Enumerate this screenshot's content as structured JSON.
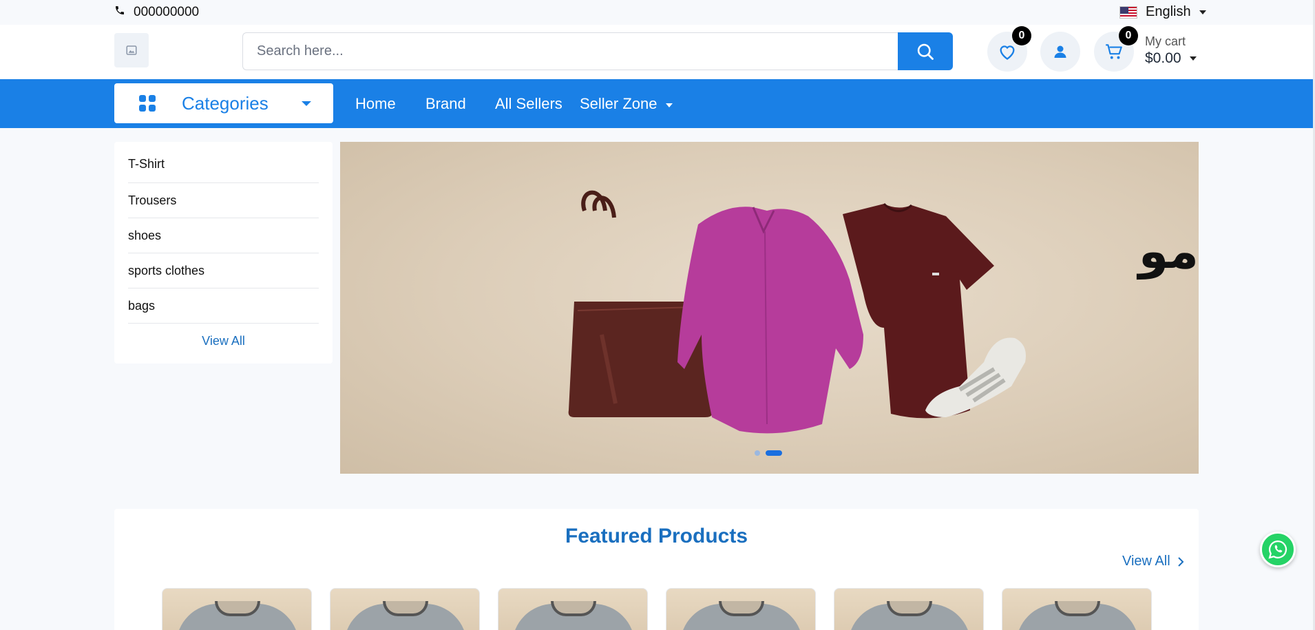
{
  "topbar": {
    "phone": "000000000",
    "language": "English"
  },
  "header": {
    "search_placeholder": "Search here...",
    "wishlist_count": "0",
    "cart_count": "0",
    "cart_label": "My cart",
    "cart_total": "$0.00"
  },
  "nav": {
    "categories_label": "Categories",
    "links": [
      "Home",
      "Brand",
      "All Sellers",
      "Seller Zone"
    ]
  },
  "sidebar": {
    "items": [
      "T-Shirt",
      "Trousers",
      "shoes",
      "sports clothes",
      "bags"
    ],
    "view_all": "View All"
  },
  "banner": {
    "overlay_text": "مو",
    "slides": 2,
    "active_slide": 2
  },
  "featured": {
    "title": "Featured Products",
    "view_all": "View All",
    "product_count": 6
  },
  "colors": {
    "primary": "#1a80e6",
    "link": "#1a6fbf",
    "whatsapp": "#25d366"
  }
}
